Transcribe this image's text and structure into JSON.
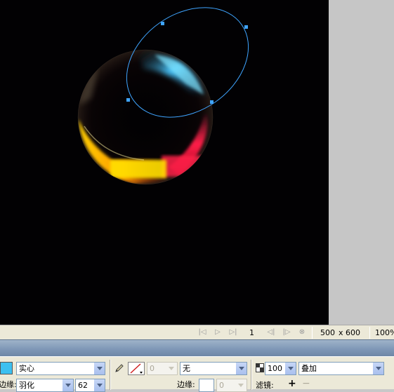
{
  "document": {
    "canvas_width": "500",
    "size_separator": "x",
    "canvas_height": "600",
    "zoom": "100%",
    "frame_number": "1"
  },
  "properties": {
    "fill_type": "实心",
    "edge_label": "边缘:",
    "edge_type": "羽化",
    "feather_amount": "62",
    "stroke_width": "0",
    "stroke_category": "无",
    "stroke_edge_label": "边缘:",
    "stroke_edge_value": "0",
    "opacity": "100",
    "blend_mode": "叠加",
    "filters_label": "滤镜:",
    "add_filter": "+",
    "remove_filter": "−",
    "fill_color": "#3cc0f0",
    "stroke_color": "#d02020"
  },
  "icons": [
    "first-frame-icon",
    "play-icon",
    "last-frame-icon",
    "prev-frame-icon",
    "next-frame-icon",
    "loop-icon",
    "pencil-icon",
    "stroke-swatch-icon",
    "opacity-icon"
  ]
}
